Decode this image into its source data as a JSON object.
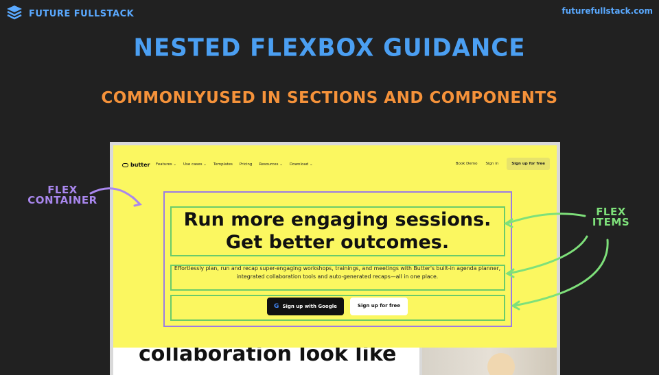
{
  "brand": {
    "name": "FUTURE FULLSTACK",
    "icon": "stack-layers-icon"
  },
  "site_url": "futurefullstack.com",
  "slide": {
    "title": "NESTED FLEXBOX GUIDANCE",
    "subtitle": "COMMONLYUSED IN SECTIONS AND COMPONENTS"
  },
  "annotations": {
    "flex_container": "FLEX CONTAINER",
    "flex_items": "FLEX ITEMS"
  },
  "screenshot": {
    "logo": "butter",
    "nav": {
      "links": [
        "Features ⌄",
        "Use cases ⌄",
        "Templates",
        "Pricing",
        "Resources ⌄",
        "Download ⌄"
      ],
      "book_demo": "Book Demo",
      "sign_in": "Sign in",
      "cta": "Sign up for free"
    },
    "hero": {
      "headline_line1": "Run more engaging sessions.",
      "headline_line2": "Get better outcomes.",
      "description": "Effortlessly plan, run and recap super-engaging workshops, trainings, and meetings with Butter's built-in agenda planner, integrated collaboration tools and auto-generated recaps—all in one place.",
      "google_button": "Sign up with Google",
      "free_button": "Sign up for free"
    },
    "below_fold_text": "collaboration look like"
  },
  "colors": {
    "background": "#212121",
    "title": "#4b9ff2",
    "subtitle": "#f5923a",
    "container_outline": "#9b7be4",
    "item_outline": "#6acb6a",
    "hero_background": "#fbf760"
  }
}
